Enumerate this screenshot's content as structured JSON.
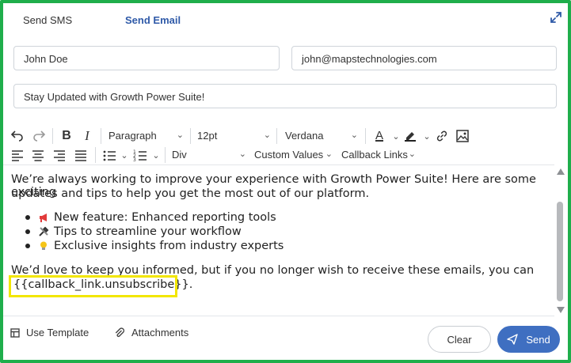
{
  "tabs": [
    {
      "label": "Send SMS",
      "active": false
    },
    {
      "label": "Send Email",
      "active": true
    }
  ],
  "fields": {
    "name": "John Doe",
    "email": "john@mapstechnologies.com",
    "subject": "Stay Updated with Growth Power Suite!"
  },
  "toolbar": {
    "paragraph": "Paragraph",
    "font_size": "12pt",
    "font_family": "Verdana",
    "block": "Div",
    "custom_values": "Custom Values",
    "callback_links": "Callback Links"
  },
  "editor": {
    "intro_line1": "We’re always working to improve your experience with Growth Power Suite! Here are some exciting",
    "intro_line2": "updates and tips to help you get the most out of our platform.",
    "bullets": [
      {
        "icon": "megaphone-icon",
        "text": "New feature: Enhanced reporting tools"
      },
      {
        "icon": "tools-icon",
        "text": "Tips to streamline your workflow"
      },
      {
        "icon": "lightbulb-icon",
        "text": "Exclusive insights from industry experts"
      }
    ],
    "outro_line1": "We’d love to keep you informed, but if you no longer wish to receive these emails, you can",
    "outro_line2": "{{callback_link.unsubscribe}}."
  },
  "footer": {
    "use_template": "Use Template",
    "attachments": "Attachments",
    "clear": "Clear",
    "send": "Send"
  },
  "colors": {
    "frame": "#1fae4b",
    "accent": "#3f6fc1",
    "highlight": "#f2e600"
  }
}
